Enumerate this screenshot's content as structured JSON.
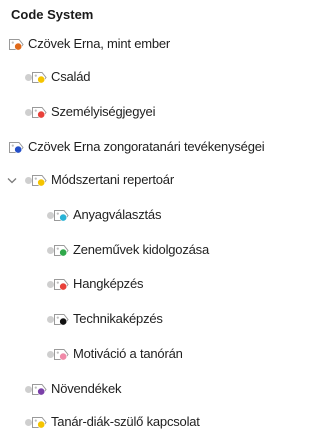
{
  "panel": {
    "title": "Code System"
  },
  "tree": [
    {
      "label": "Czövek Erna, mint ember",
      "color": "#e06a1b",
      "level": 0,
      "expander": "none"
    },
    {
      "label": "Család",
      "color": "#f5c400",
      "level": 1,
      "expander": "bullet"
    },
    {
      "label": "Személyiségjegyei",
      "color": "#e8413a",
      "level": 1,
      "expander": "bullet"
    },
    {
      "label": "Czövek Erna zongoratanári tevékenységei",
      "color": "#2550c8",
      "level": 0,
      "expander": "none"
    },
    {
      "label": "Módszertani repertoár",
      "color": "#f5c400",
      "level": 1,
      "expander": "chevron"
    },
    {
      "label": "Anyagválasztás",
      "color": "#2ab3d6",
      "level": 2,
      "expander": "bullet"
    },
    {
      "label": "Zeneművek kidolgozása",
      "color": "#2fa84a",
      "level": 2,
      "expander": "bullet"
    },
    {
      "label": "Hangképzés",
      "color": "#e8413a",
      "level": 2,
      "expander": "bullet"
    },
    {
      "label": "Technikaképzés",
      "color": "#111111",
      "level": 2,
      "expander": "bullet"
    },
    {
      "label": "Motiváció a tanórán",
      "color": "#f08aa8",
      "level": 2,
      "expander": "bullet"
    },
    {
      "label": "Növendékek",
      "color": "#7a3fa8",
      "level": 1,
      "expander": "bullet"
    },
    {
      "label": "Tanár-diák-szülő kapcsolat",
      "color": "#f5c400",
      "level": 1,
      "expander": "bullet"
    }
  ],
  "icons": {
    "chevron": "chevron-down-icon",
    "code": "code-tag-icon"
  }
}
